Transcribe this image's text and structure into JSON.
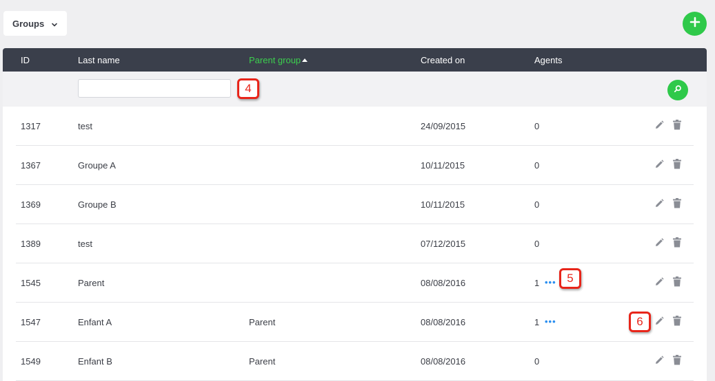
{
  "toolbar": {
    "groups_label": "Groups",
    "add_icon": "plus-icon",
    "accent": "#2fc94a"
  },
  "table": {
    "header_bg": "#3a3f4b",
    "sorted_color": "#3ccf4e",
    "columns": [
      {
        "label": "ID"
      },
      {
        "label": "Last name"
      },
      {
        "label": "Parent group",
        "sorted": "ascending"
      },
      {
        "label": "Created on"
      },
      {
        "label": "Agents"
      }
    ],
    "filter": {
      "value": "",
      "placeholder": "",
      "search_icon": "search-icon"
    },
    "rows": [
      {
        "id": "1317",
        "last_name": "test",
        "parent": "",
        "created": "24/09/2015",
        "agents": "0",
        "more": ""
      },
      {
        "id": "1367",
        "last_name": "Groupe A",
        "parent": "",
        "created": "10/11/2015",
        "agents": "0",
        "more": ""
      },
      {
        "id": "1369",
        "last_name": "Groupe B",
        "parent": "",
        "created": "10/11/2015",
        "agents": "0",
        "more": ""
      },
      {
        "id": "1389",
        "last_name": "test",
        "parent": "",
        "created": "07/12/2015",
        "agents": "0",
        "more": ""
      },
      {
        "id": "1545",
        "last_name": "Parent",
        "parent": "",
        "created": "08/08/2016",
        "agents": "1",
        "more": "•••"
      },
      {
        "id": "1547",
        "last_name": "Enfant A",
        "parent": "Parent",
        "created": "08/08/2016",
        "agents": "1",
        "more": "•••"
      },
      {
        "id": "1549",
        "last_name": "Enfant B",
        "parent": "Parent",
        "created": "08/08/2016",
        "agents": "0",
        "more": ""
      }
    ]
  },
  "annotations": {
    "badge_4": "4",
    "badge_5": "5",
    "badge_6": "6"
  }
}
